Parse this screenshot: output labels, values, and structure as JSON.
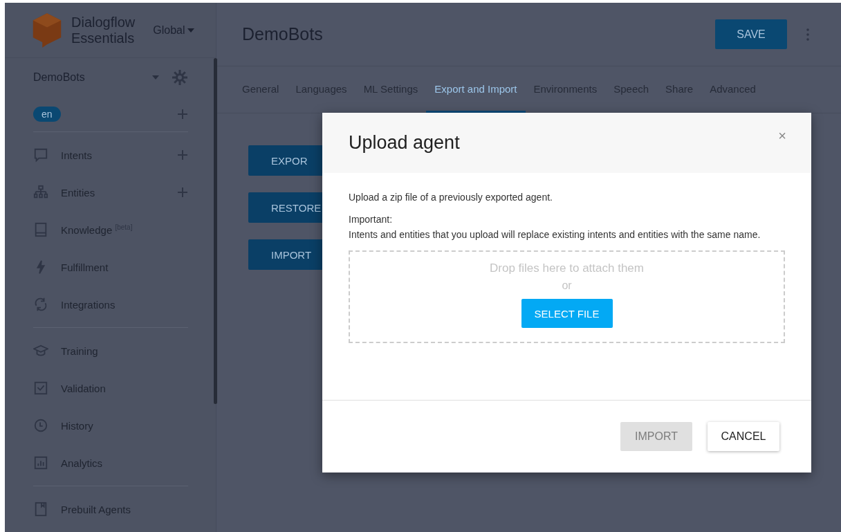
{
  "brand": {
    "line_1": "Dialogflow",
    "line_2": "Essentials",
    "region": "Global"
  },
  "sidebar": {
    "agent": "DemoBots",
    "language": "en",
    "groups": [
      [
        {
          "label": "Intents",
          "has_add": true
        },
        {
          "label": "Entities",
          "has_add": true
        },
        {
          "label": "Knowledge $^{[beta]}$",
          "has_add": false
        },
        {
          "label": "Fulfillment",
          "has_add": false
        },
        {
          "label": "Integrations",
          "has_add": false
        }
      ],
      [
        {
          "label": "Training",
          "has_add": false
        },
        {
          "label": "Validation",
          "has_add": false
        },
        {
          "label": "History",
          "has_add": false
        },
        {
          "label": "Analytics",
          "has_add": false
        }
      ],
      [
        {
          "label": "Prebuilt Agents",
          "has_add": false
        }
      ]
    ]
  },
  "header": {
    "title": "DemoBots",
    "save": "SAVE"
  },
  "tabs": [
    {
      "label": "General",
      "selected": false
    },
    {
      "label": "Languages",
      "selected": false
    },
    {
      "label": "ML Settings",
      "selected": false
    },
    {
      "label": "Export and Import",
      "selected": true
    },
    {
      "label": "Environments",
      "selected": false
    },
    {
      "label": "Speech",
      "selected": false
    },
    {
      "label": "Share",
      "selected": false
    },
    {
      "label": "Advanced",
      "selected": false
    }
  ],
  "actions": [
    "EXPOR",
    "RESTORE",
    "IMPORT"
  ],
  "dialog": {
    "title": "Upload agent",
    "close": "×",
    "intro": "Upload a zip file of a previously exported agent.",
    "important": "Important:",
    "note": "Intents and entities that you upload will replace existing intents and entities with the same name.",
    "drop_text": "Drop files here to attach them",
    "or": "or",
    "select": "SELECT FILE",
    "import": {
      "label": "IMPORT",
      "disabled": true
    },
    "cancel": "CANCEL"
  }
}
